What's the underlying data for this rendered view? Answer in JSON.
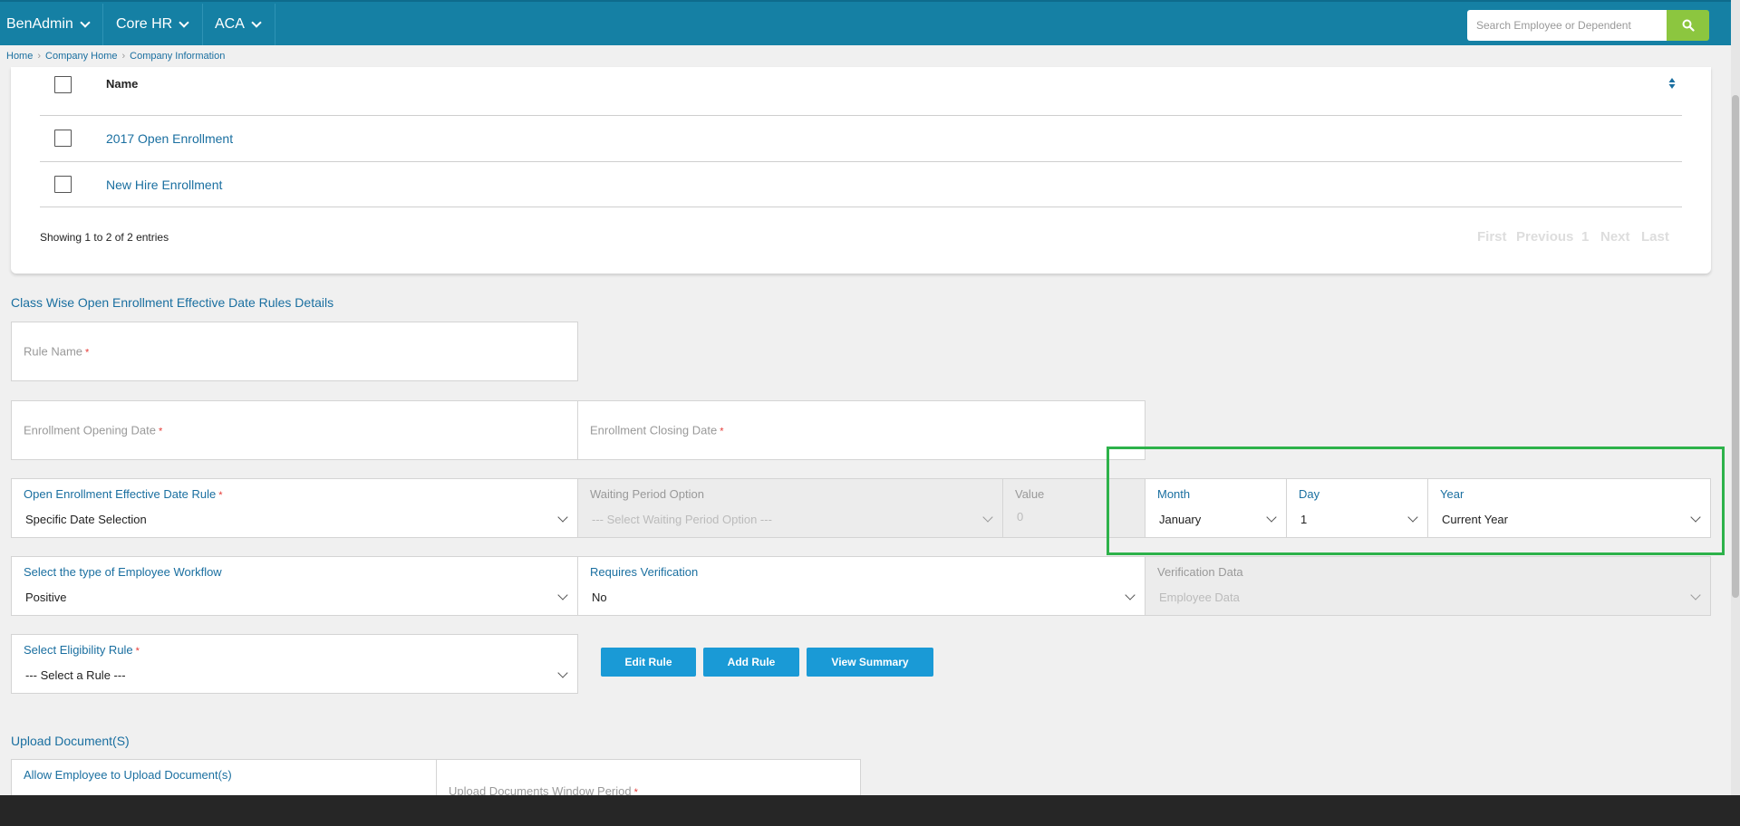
{
  "nav": {
    "items": [
      {
        "label": "BenAdmin"
      },
      {
        "label": "Core HR"
      },
      {
        "label": "ACA"
      }
    ],
    "search_placeholder": "Search Employee or Dependent"
  },
  "breadcrumb": [
    "Home",
    "Company Home",
    "Company Information"
  ],
  "table": {
    "header_name": "Name",
    "rows": [
      "2017 Open Enrollment",
      "New Hire Enrollment"
    ],
    "entries_text": "Showing 1 to 2 of 2 entries",
    "pager": {
      "first": "First",
      "previous": "Previous",
      "page": "1",
      "next": "Next",
      "last": "Last"
    }
  },
  "section_title": "Class Wise Open Enrollment Effective Date Rules Details",
  "fields": {
    "rule_name": {
      "label": "Rule Name"
    },
    "opening_date": {
      "label": "Enrollment Opening Date"
    },
    "closing_date": {
      "label": "Enrollment Closing Date"
    },
    "effective_rule": {
      "label": "Open Enrollment Effective Date Rule",
      "value": "Specific Date Selection"
    },
    "waiting_period": {
      "label": "Waiting Period Option",
      "value": "--- Select Waiting Period Option ---"
    },
    "value_field": {
      "label": "Value",
      "value": "0"
    },
    "month": {
      "label": "Month",
      "value": "January"
    },
    "day": {
      "label": "Day",
      "value": "1"
    },
    "year": {
      "label": "Year",
      "value": "Current Year"
    },
    "workflow": {
      "label": "Select the type of Employee Workflow",
      "value": "Positive"
    },
    "verification": {
      "label": "Requires Verification",
      "value": "No"
    },
    "verification_data": {
      "label": "Verification Data",
      "value": "Employee Data"
    },
    "eligibility": {
      "label": "Select Eligibility Rule",
      "value": "--- Select a Rule ---"
    }
  },
  "buttons": {
    "edit": "Edit Rule",
    "add": "Add Rule",
    "summary": "View Summary"
  },
  "upload": {
    "title": "Upload Document(S)",
    "allow_label": "Allow Employee to Upload Document(s)",
    "window_label": "Upload Documents Window Period"
  },
  "required_mark": "*",
  "colors": {
    "nav": "#1580a4",
    "link": "#1a6fa0",
    "button": "#1a9ad6",
    "search_button": "#8cc63f",
    "highlight": "#2db24a"
  }
}
